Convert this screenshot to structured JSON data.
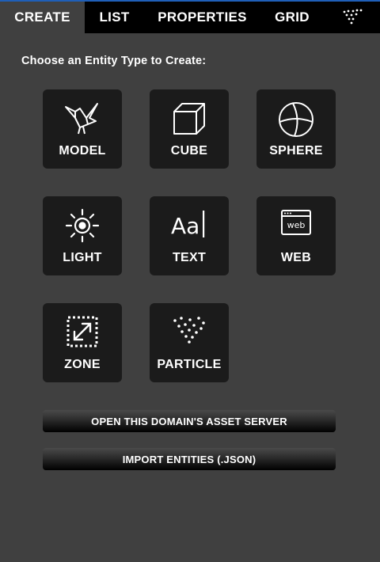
{
  "tabs": {
    "create": "CREATE",
    "list": "LIST",
    "properties": "PROPERTIES",
    "grid": "GRID",
    "menu_icon": "dots-triangle-icon"
  },
  "heading": "Choose an Entity Type to Create:",
  "entities": {
    "model": {
      "label": "MODEL",
      "icon": "bird-icon"
    },
    "cube": {
      "label": "CUBE",
      "icon": "cube-icon"
    },
    "sphere": {
      "label": "SPHERE",
      "icon": "sphere-icon"
    },
    "light": {
      "label": "LIGHT",
      "icon": "sun-icon"
    },
    "text": {
      "label": "TEXT",
      "icon": "text-cursor-icon"
    },
    "web": {
      "label": "WEB",
      "icon": "browser-icon",
      "icon_text": "web"
    },
    "zone": {
      "label": "ZONE",
      "icon": "zone-icon"
    },
    "particle": {
      "label": "PARTICLE",
      "icon": "particles-icon"
    }
  },
  "buttons": {
    "asset_server": "OPEN THIS DOMAIN'S ASSET SERVER",
    "import": "IMPORT ENTITIES (.JSON)"
  },
  "colors": {
    "background": "#404040",
    "tab_bar": "#000000",
    "tile": "#1b1b1b",
    "text": "#ffffff"
  }
}
